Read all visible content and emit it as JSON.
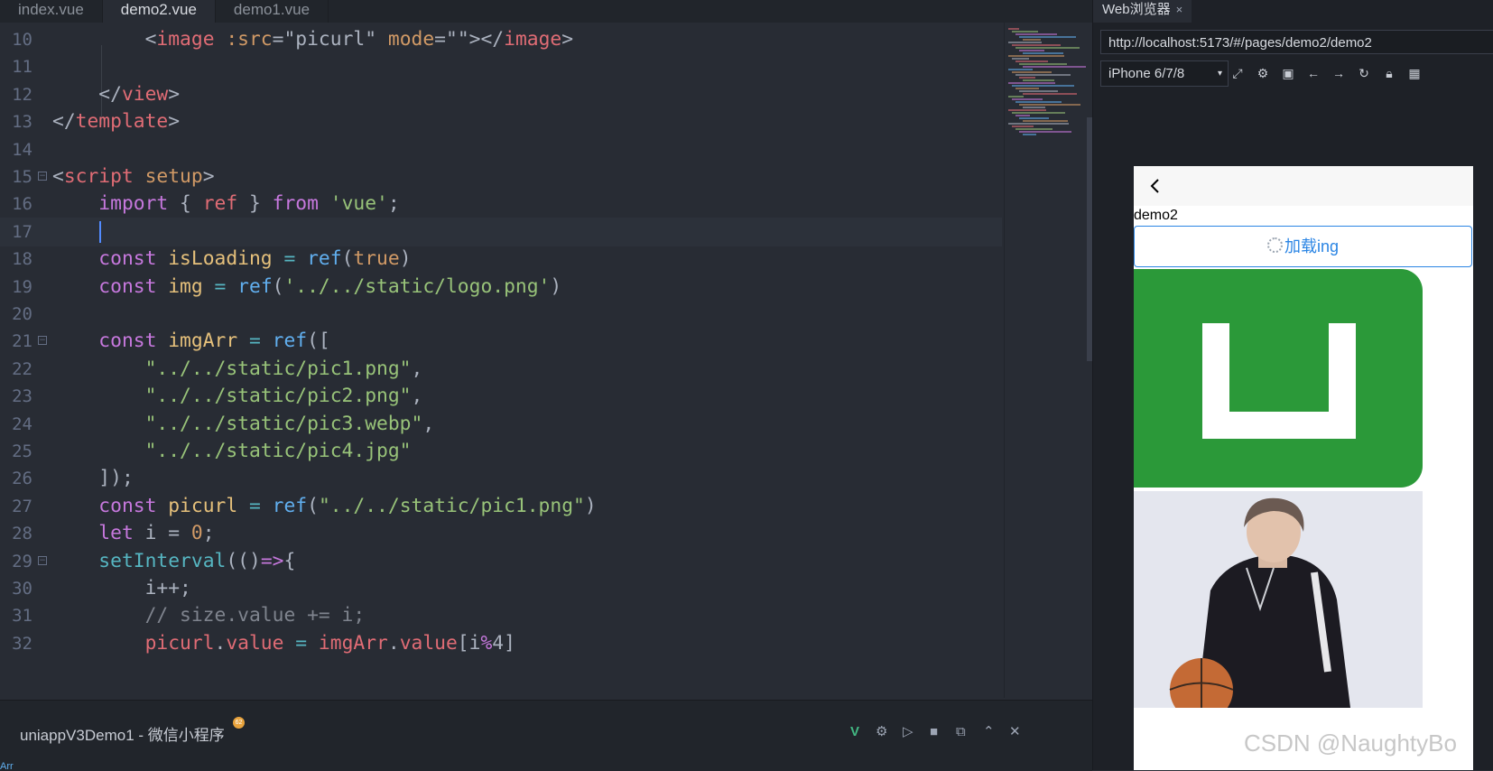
{
  "editor": {
    "tabs": [
      {
        "label": "index.vue"
      },
      {
        "label": "demo2.vue"
      },
      {
        "label": "demo1.vue"
      }
    ],
    "lines": [
      {
        "n": "10",
        "tokens": [
          {
            "t": "        ",
            "c": "pun"
          },
          {
            "t": "<",
            "c": "pun"
          },
          {
            "t": "image",
            "c": "tag"
          },
          {
            "t": " ",
            "c": "pun"
          },
          {
            "t": ":src",
            "c": "attr"
          },
          {
            "t": "=",
            "c": "pun"
          },
          {
            "t": "\"picurl\"",
            "c": "pun"
          },
          {
            "t": " ",
            "c": "pun"
          },
          {
            "t": "mode",
            "c": "attr"
          },
          {
            "t": "=",
            "c": "pun"
          },
          {
            "t": "\"\"",
            "c": "pun"
          },
          {
            "t": "></",
            "c": "pun"
          },
          {
            "t": "image",
            "c": "tag"
          },
          {
            "t": ">",
            "c": "pun"
          }
        ]
      },
      {
        "n": "11",
        "tokens": []
      },
      {
        "n": "12",
        "tokens": [
          {
            "t": "    ",
            "c": "pun"
          },
          {
            "t": "</",
            "c": "pun"
          },
          {
            "t": "view",
            "c": "tag"
          },
          {
            "t": ">",
            "c": "pun"
          }
        ]
      },
      {
        "n": "13",
        "tokens": [
          {
            "t": "</",
            "c": "pun"
          },
          {
            "t": "template",
            "c": "tag"
          },
          {
            "t": ">",
            "c": "pun"
          }
        ]
      },
      {
        "n": "14",
        "tokens": []
      },
      {
        "n": "15",
        "fold": true,
        "tokens": [
          {
            "t": "<",
            "c": "pun"
          },
          {
            "t": "script",
            "c": "tag"
          },
          {
            "t": " ",
            "c": "pun"
          },
          {
            "t": "setup",
            "c": "attr"
          },
          {
            "t": ">",
            "c": "pun"
          }
        ]
      },
      {
        "n": "16",
        "tokens": [
          {
            "t": "    ",
            "c": "pun"
          },
          {
            "t": "import",
            "c": "kw"
          },
          {
            "t": " { ",
            "c": "pun"
          },
          {
            "t": "ref",
            "c": "prop"
          },
          {
            "t": " } ",
            "c": "pun"
          },
          {
            "t": "from",
            "c": "kw"
          },
          {
            "t": " ",
            "c": "pun"
          },
          {
            "t": "'vue'",
            "c": "str"
          },
          {
            "t": ";",
            "c": "pun"
          }
        ]
      },
      {
        "n": "17",
        "current": true,
        "tokens": []
      },
      {
        "n": "18",
        "tokens": [
          {
            "t": "    ",
            "c": "pun"
          },
          {
            "t": "const",
            "c": "kw"
          },
          {
            "t": " ",
            "c": "pun"
          },
          {
            "t": "isLoading",
            "c": "var"
          },
          {
            "t": " = ",
            "c": "op"
          },
          {
            "t": "ref",
            "c": "fn"
          },
          {
            "t": "(",
            "c": "pun"
          },
          {
            "t": "true",
            "c": "num"
          },
          {
            "t": ")",
            "c": "pun"
          }
        ]
      },
      {
        "n": "19",
        "tokens": [
          {
            "t": "    ",
            "c": "pun"
          },
          {
            "t": "const",
            "c": "kw"
          },
          {
            "t": " ",
            "c": "pun"
          },
          {
            "t": "img",
            "c": "var"
          },
          {
            "t": " = ",
            "c": "op"
          },
          {
            "t": "ref",
            "c": "fn"
          },
          {
            "t": "(",
            "c": "pun"
          },
          {
            "t": "'../../static/logo.png'",
            "c": "str"
          },
          {
            "t": ")",
            "c": "pun"
          }
        ]
      },
      {
        "n": "20",
        "tokens": []
      },
      {
        "n": "21",
        "fold": true,
        "tokens": [
          {
            "t": "    ",
            "c": "pun"
          },
          {
            "t": "const",
            "c": "kw"
          },
          {
            "t": " ",
            "c": "pun"
          },
          {
            "t": "imgArr",
            "c": "var"
          },
          {
            "t": " = ",
            "c": "op"
          },
          {
            "t": "ref",
            "c": "fn"
          },
          {
            "t": "([",
            "c": "pun"
          }
        ]
      },
      {
        "n": "22",
        "tokens": [
          {
            "t": "        ",
            "c": "pun"
          },
          {
            "t": "\"../../static/pic1.png\"",
            "c": "str"
          },
          {
            "t": ",",
            "c": "pun"
          }
        ]
      },
      {
        "n": "23",
        "tokens": [
          {
            "t": "        ",
            "c": "pun"
          },
          {
            "t": "\"../../static/pic2.png\"",
            "c": "str"
          },
          {
            "t": ",",
            "c": "pun"
          }
        ]
      },
      {
        "n": "24",
        "tokens": [
          {
            "t": "        ",
            "c": "pun"
          },
          {
            "t": "\"../../static/pic3.webp\"",
            "c": "str"
          },
          {
            "t": ",",
            "c": "pun"
          }
        ]
      },
      {
        "n": "25",
        "tokens": [
          {
            "t": "        ",
            "c": "pun"
          },
          {
            "t": "\"../../static/pic4.jpg\"",
            "c": "str"
          }
        ]
      },
      {
        "n": "26",
        "tokens": [
          {
            "t": "    ",
            "c": "pun"
          },
          {
            "t": "]);",
            "c": "pun"
          }
        ]
      },
      {
        "n": "27",
        "tokens": [
          {
            "t": "    ",
            "c": "pun"
          },
          {
            "t": "const",
            "c": "kw"
          },
          {
            "t": " ",
            "c": "pun"
          },
          {
            "t": "picurl",
            "c": "var"
          },
          {
            "t": " = ",
            "c": "op"
          },
          {
            "t": "ref",
            "c": "fn"
          },
          {
            "t": "(",
            "c": "pun"
          },
          {
            "t": "\"../../static/pic1.png\"",
            "c": "str"
          },
          {
            "t": ")",
            "c": "pun"
          }
        ]
      },
      {
        "n": "28",
        "tokens": [
          {
            "t": "    ",
            "c": "pun"
          },
          {
            "t": "let",
            "c": "kw"
          },
          {
            "t": " i = ",
            "c": "pun"
          },
          {
            "t": "0",
            "c": "num"
          },
          {
            "t": ";",
            "c": "pun"
          }
        ]
      },
      {
        "n": "29",
        "fold": true,
        "tokens": [
          {
            "t": "    ",
            "c": "pun"
          },
          {
            "t": "setInterval",
            "c": "op"
          },
          {
            "t": "(()",
            "c": "pun"
          },
          {
            "t": "=>",
            "c": "kw"
          },
          {
            "t": "{",
            "c": "pun"
          }
        ]
      },
      {
        "n": "30",
        "tokens": [
          {
            "t": "        ",
            "c": "pun"
          },
          {
            "t": "i++;",
            "c": "pun"
          }
        ]
      },
      {
        "n": "31",
        "tokens": [
          {
            "t": "        ",
            "c": "pun"
          },
          {
            "t": "// size.value += i;",
            "c": "com"
          }
        ]
      },
      {
        "n": "32",
        "tokens": [
          {
            "t": "        ",
            "c": "pun"
          },
          {
            "t": "picurl",
            "c": "prop"
          },
          {
            "t": ".",
            "c": "pun"
          },
          {
            "t": "value",
            "c": "prop"
          },
          {
            "t": " = ",
            "c": "op"
          },
          {
            "t": "imgArr",
            "c": "prop"
          },
          {
            "t": ".",
            "c": "pun"
          },
          {
            "t": "value",
            "c": "prop"
          },
          {
            "t": "[i",
            "c": "pun"
          },
          {
            "t": "%",
            "c": "kw"
          },
          {
            "t": "4]",
            "c": "pun"
          }
        ]
      }
    ]
  },
  "status": {
    "project": "uniappV3Demo1 - 微信小程序",
    "badge": "62",
    "bottom_text": "Arr"
  },
  "browser": {
    "tab_label": "Web浏览器",
    "tab_close": "×",
    "url": "http://localhost:5173/#/pages/demo2/demo2",
    "device": "iPhone 6/7/8",
    "phone": {
      "page_text": "demo2",
      "button_label": "加载ing"
    }
  },
  "watermark": "CSDN @NaughtyBo",
  "colors": {
    "editor_bg": "#282c34",
    "button_blue": "#2b85e4",
    "logo_green": "#2b9939"
  }
}
